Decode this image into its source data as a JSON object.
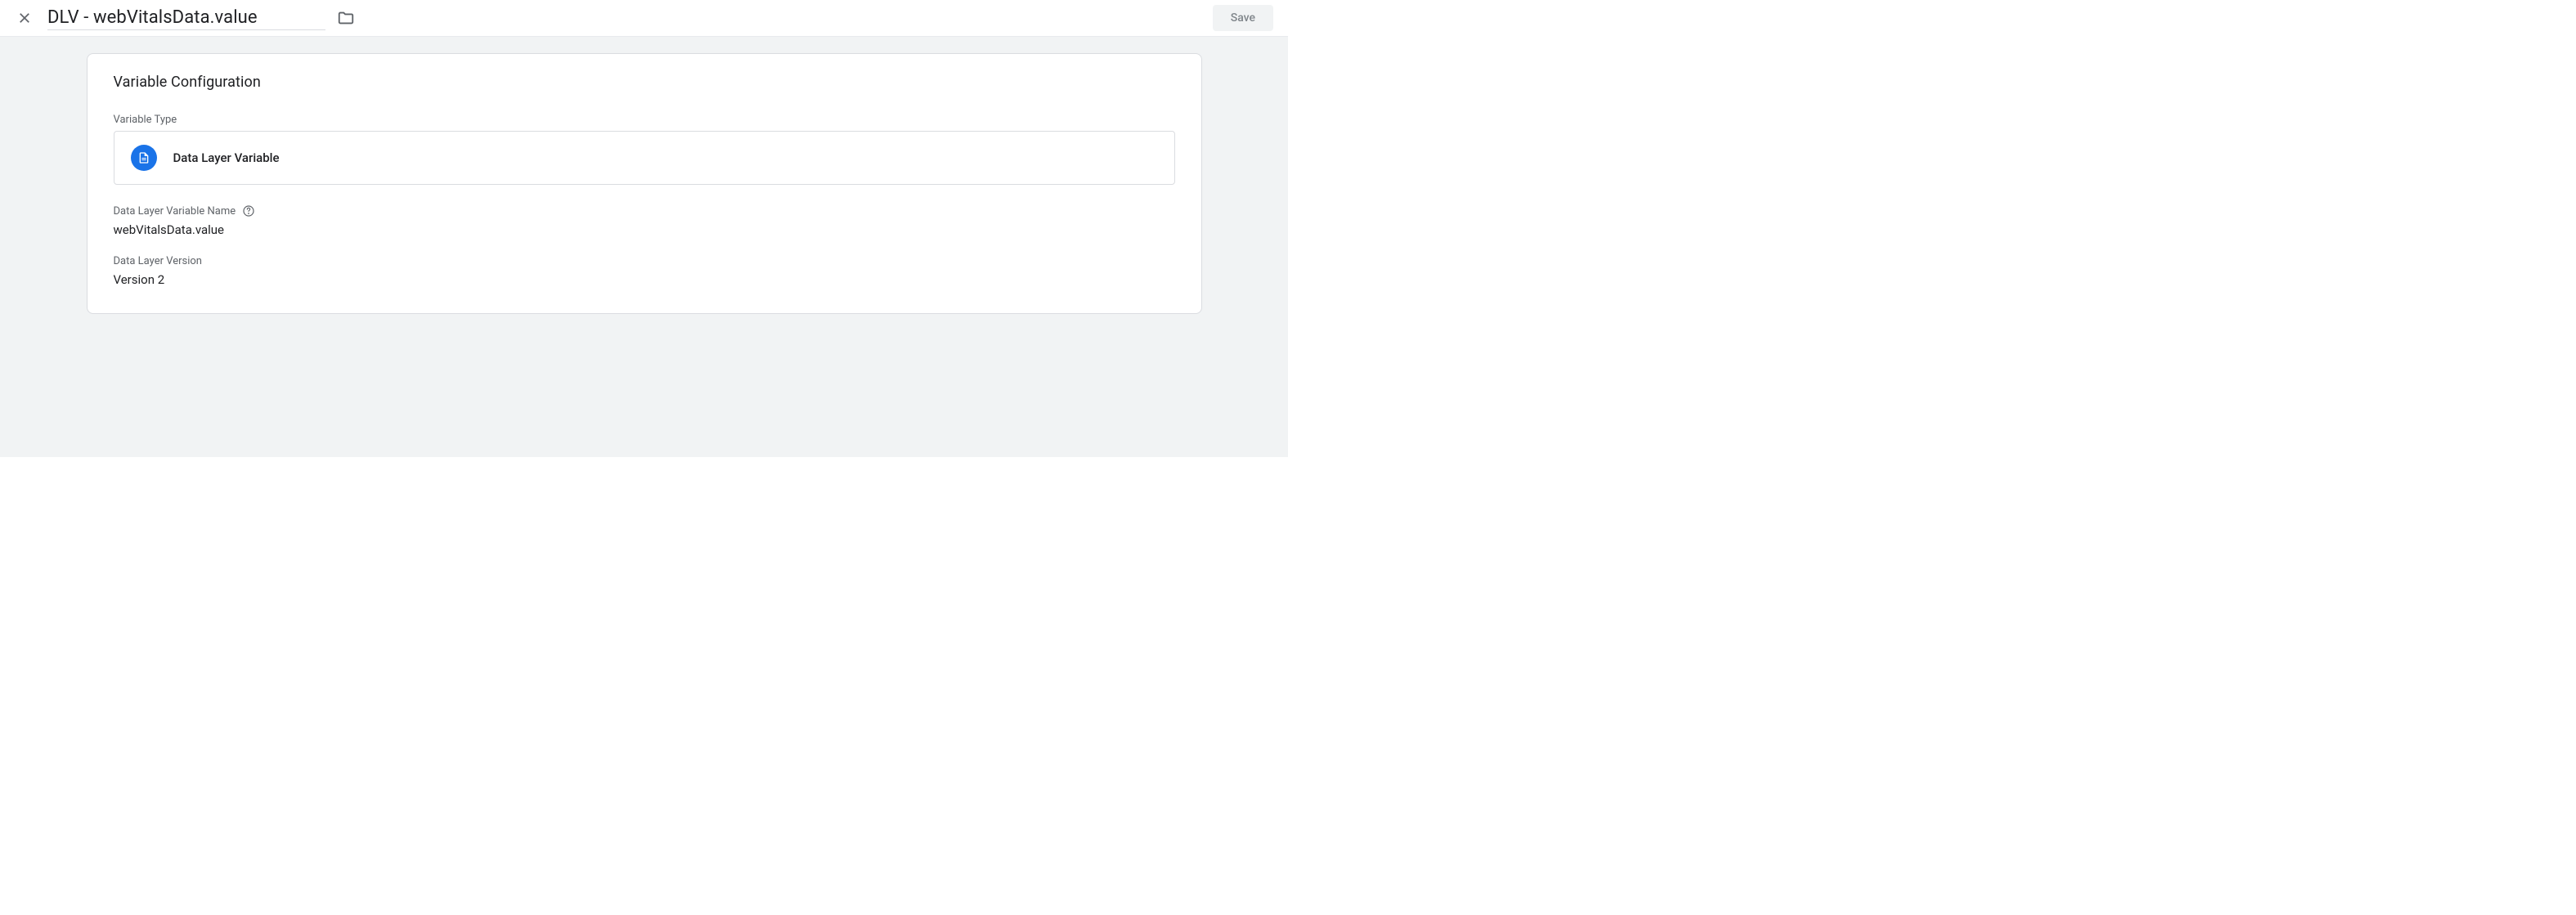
{
  "header": {
    "title_value": "DLV - webVitalsData.value",
    "save_label": "Save"
  },
  "card": {
    "title": "Variable Configuration",
    "variable_type_label": "Variable Type",
    "variable_type_name": "Data Layer Variable",
    "dlv_name_label": "Data Layer Variable Name",
    "dlv_name_value": "webVitalsData.value",
    "dlv_version_label": "Data Layer Version",
    "dlv_version_value": "Version 2"
  }
}
